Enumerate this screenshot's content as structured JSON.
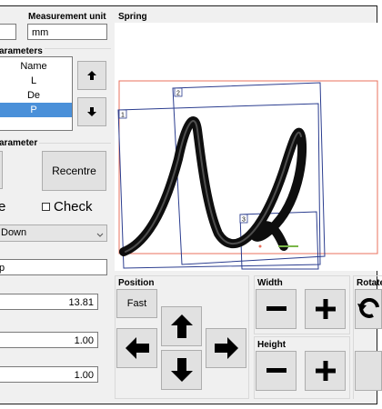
{
  "header": {
    "measurement_unit_label": "Measurement unit",
    "measurement_unit_value": "mm"
  },
  "parameters": {
    "title": "arameters",
    "column_header": "Name",
    "items": [
      "L",
      "De",
      "P"
    ],
    "selected_index": 2
  },
  "parameter_group": {
    "title": "arameter",
    "recentre_label": "Recentre",
    "partial_label": "e",
    "check_label": "Check",
    "dropdown_value": "Down",
    "field_partial": "p"
  },
  "values": {
    "value1": "13.81",
    "value2": "1.00",
    "value3": "1.00"
  },
  "spring": {
    "title": "Spring",
    "box_labels": [
      "1",
      "2",
      "3"
    ]
  },
  "position": {
    "title": "Position",
    "fast_label": "Fast"
  },
  "width": {
    "title": "Width"
  },
  "height": {
    "title": "Height"
  },
  "rotate": {
    "title": "Rotate"
  },
  "icons": {
    "move_up": "arrow-up-icon",
    "move_down": "arrow-down-icon",
    "left": "arrow-left-icon",
    "right": "arrow-right-icon",
    "minus": "minus-icon",
    "plus": "plus-icon",
    "rotate": "rotate-icon",
    "dropdown": "chevron-down-icon"
  },
  "colors": {
    "selection": "#4a90d9",
    "outer_box": "#e8705c",
    "inner_boxes": "#2b3d8f",
    "end_marker": "#7ab648"
  }
}
